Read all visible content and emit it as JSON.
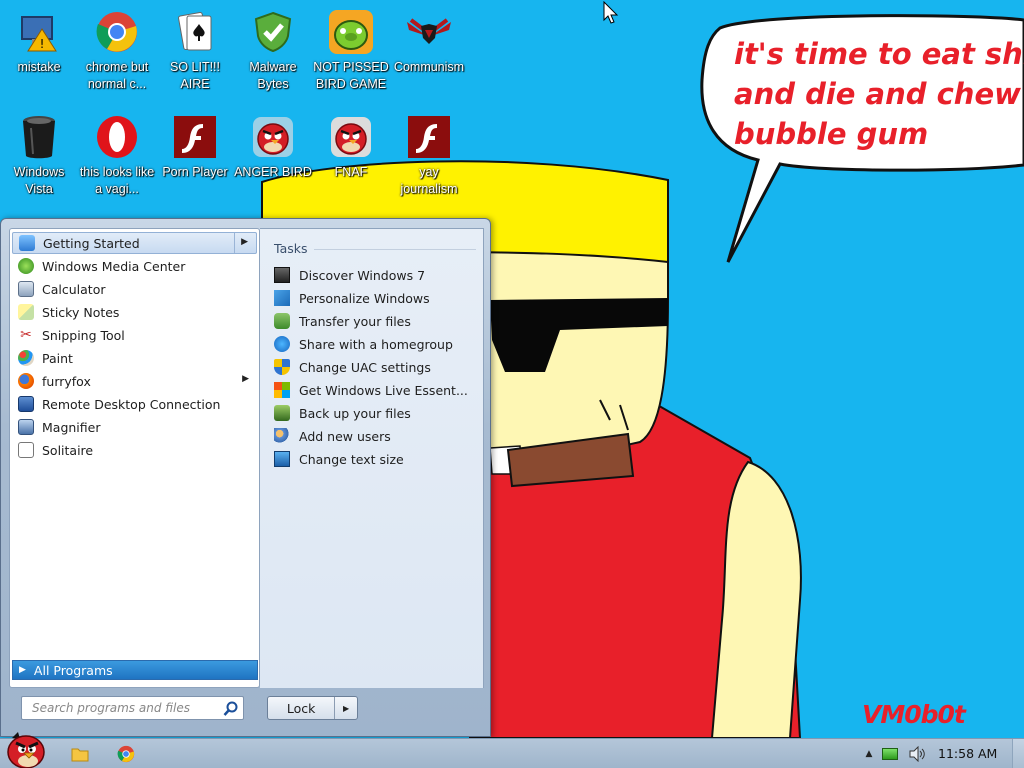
{
  "wallpaper": {
    "speech": "it's time to eat shit\nand die and chew\nbubble gum",
    "signature": "VM0b0t",
    "colors": {
      "sky": "#17b5ef",
      "text": "#e8202a",
      "hair": "#ffee00",
      "skin": "#fef7b4",
      "shirt": "#e8202a"
    }
  },
  "desktop_icons": [
    {
      "label": "mistake",
      "icon": "monitor-warning-icon"
    },
    {
      "label": "chrome but normal c...",
      "icon": "chrome-icon"
    },
    {
      "label": "SO LIT!!! AIRE",
      "icon": "solitaire-icon"
    },
    {
      "label": "Malware Bytes",
      "icon": "shield-check-icon"
    },
    {
      "label": "NOT PISSED BIRD GAME",
      "icon": "green-pig-icon"
    },
    {
      "label": "Communism",
      "icon": "winged-emblem-icon"
    },
    {
      "label": "Windows Vista",
      "icon": "trash-bin-icon"
    },
    {
      "label": "this looks like a vagi...",
      "icon": "opera-icon"
    },
    {
      "label": "Porn Player",
      "icon": "flash-icon"
    },
    {
      "label": "ANGER BIRD",
      "icon": "angry-bird-icon"
    },
    {
      "label": "FNAF",
      "icon": "angry-bird-icon"
    },
    {
      "label": "yay journalism",
      "icon": "flash-icon"
    }
  ],
  "start_menu": {
    "programs": [
      {
        "label": "Getting Started",
        "icon": "getting-started-icon",
        "submenu": true,
        "selected": true
      },
      {
        "label": "Windows Media Center",
        "icon": "media-center-icon"
      },
      {
        "label": "Calculator",
        "icon": "calculator-icon"
      },
      {
        "label": "Sticky Notes",
        "icon": "sticky-notes-icon"
      },
      {
        "label": "Snipping Tool",
        "icon": "scissors-icon"
      },
      {
        "label": "Paint",
        "icon": "paint-palette-icon"
      },
      {
        "label": "furryfox",
        "icon": "firefox-icon",
        "submenu": true
      },
      {
        "label": "Remote Desktop Connection",
        "icon": "remote-desktop-icon"
      },
      {
        "label": "Magnifier",
        "icon": "magnifier-icon"
      },
      {
        "label": "Solitaire",
        "icon": "solitaire-icon"
      }
    ],
    "all_programs": "All Programs",
    "tasks_title": "Tasks",
    "tasks": [
      {
        "label": "Discover Windows 7",
        "icon": "discover-icon"
      },
      {
        "label": "Personalize Windows",
        "icon": "personalize-icon"
      },
      {
        "label": "Transfer your files",
        "icon": "transfer-icon"
      },
      {
        "label": "Share with a homegroup",
        "icon": "homegroup-icon"
      },
      {
        "label": "Change UAC settings",
        "icon": "uac-shield-icon"
      },
      {
        "label": "Get Windows Live Essent...",
        "icon": "windows-flag-icon"
      },
      {
        "label": "Back up your files",
        "icon": "backup-icon"
      },
      {
        "label": "Add new users",
        "icon": "users-icon"
      },
      {
        "label": "Change text size",
        "icon": "display-icon"
      }
    ],
    "search_placeholder": "Search programs and files",
    "lock_label": "Lock"
  },
  "taskbar": {
    "pinned": [
      {
        "icon": "explorer-folder-icon"
      },
      {
        "icon": "chrome-icon"
      }
    ],
    "clock": "11:58 AM",
    "tray_icons": [
      "show-hidden-icons-icon",
      "network-icon",
      "volume-icon"
    ]
  }
}
